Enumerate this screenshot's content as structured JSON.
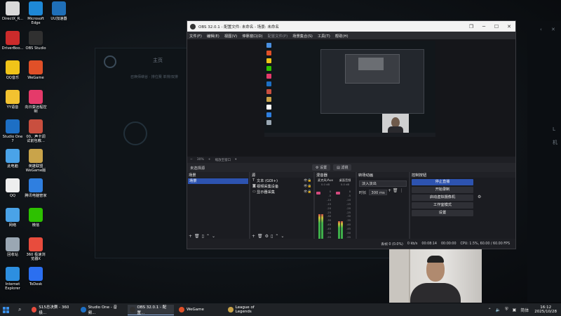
{
  "desktop": {
    "icons": [
      {
        "label": "DirectX_R...",
        "color": "#d9d9d9"
      },
      {
        "label": "Microsoft\nEdge",
        "color": "#1e88d6"
      },
      {
        "label": "UU加速器",
        "color": "#1f6fb8"
      },
      {
        "label": "DriverBoo...",
        "color": "#cc2b2b"
      },
      {
        "label": "OBS Studio",
        "color": "#303030"
      },
      {
        "label": "QQ音乐",
        "color": "#f0c419"
      },
      {
        "label": "WeGame",
        "color": "#e05028"
      },
      {
        "label": "YY语音",
        "color": "#f2c230"
      },
      {
        "label": "向日葵远程控\n制",
        "color": "#e53a6a"
      },
      {
        "label": "Studio One\n7",
        "color": "#1d6fc4"
      },
      {
        "label": "00、声卡调\n试前包教...",
        "color": "#c94f3f"
      },
      {
        "label": "此电脑",
        "color": "#4aa3e8"
      },
      {
        "label": "英雄联盟\nWeGame版",
        "color": "#c9a44a"
      },
      {
        "label": "QQ",
        "color": "#eeeeee"
      },
      {
        "label": "腾讯电脑管家",
        "color": "#2f7fe0"
      },
      {
        "label": "网络",
        "color": "#4aa3e8"
      },
      {
        "label": "微信",
        "color": "#2dc100"
      },
      {
        "label": "回收站",
        "color": "#9aa7b3"
      },
      {
        "label": "360 极速浏\n览器X",
        "color": "#e84c3d"
      },
      {
        "label": "Internet\nExplorer",
        "color": "#2d8fe0"
      },
      {
        "label": "ToDesk",
        "color": "#2b6ff0"
      }
    ]
  },
  "background_app": {
    "home": "主页",
    "search_hint": "召唤师峡谷 · 排位赛 单排/双排",
    "right_glyphs": [
      "‹",
      "✕"
    ],
    "right_labels": [
      "L",
      "机"
    ]
  },
  "obs": {
    "title": "OBS 32.0.1 - 配置文件: 未命名 - 场景: 未命名",
    "window_buttons": [
      "❐",
      "─",
      "☐",
      "✕"
    ],
    "menu": [
      "文件(F)",
      "编辑(E)",
      "视图(V)",
      "停靠窗口(D)",
      "配置文件(P)",
      "场景集合(S)",
      "工具(T)",
      "帮助(H)"
    ],
    "zoom_label": "30%",
    "zoom_hint": "缩放至窗口",
    "no_source": "未选择源",
    "props_button": "设置",
    "filters_button": "滤镜",
    "docks": {
      "scenes": {
        "title": "场景",
        "items": [
          "场景"
        ]
      },
      "sources": {
        "title": "源",
        "items": [
          {
            "icon": "T",
            "label": "文本 (GDI+)"
          },
          {
            "icon": "◙",
            "label": "视频采集设备"
          },
          {
            "icon": "▭",
            "label": "显示器采集"
          }
        ]
      },
      "mixer": {
        "title": "混音器",
        "channels": [
          {
            "name": "麦克风/Aux",
            "db": "0.0 dB",
            "level": 0.55
          },
          {
            "name": "桌面音频",
            "db": "0.0 dB",
            "level": 0.42
          }
        ],
        "scale": [
          "0",
          "-5",
          "-10",
          "-15",
          "-20",
          "-25",
          "-30",
          "-35",
          "-40",
          "-45",
          "-50",
          "-55",
          "-60"
        ]
      },
      "transitions": {
        "title": "转场动画",
        "selected": "淡入淡出",
        "duration_label": "时长",
        "duration": "300 ms"
      },
      "controls": {
        "title": "控制按钮",
        "buttons": [
          "停止直播",
          "开始录制",
          "启动虚拟摄像机",
          "工作室模式",
          "设置"
        ]
      }
    },
    "status": {
      "dropped": "丢帧 0 (0.0%)",
      "bitrate": "0 kb/s",
      "live": "00:08:14",
      "rec": "00:00:00",
      "cpu": "CPU: 1.5%, 60.00 / 60.00 FPS"
    }
  },
  "watermark": "",
  "taskbar": {
    "apps": [
      {
        "label": "S15总决赛 - 360极...",
        "color": "#e84c3d",
        "active": false
      },
      {
        "label": "Studio One - 音频...",
        "color": "#1d6fc4",
        "active": false
      },
      {
        "label": "OBS 32.0.1 - 配置...",
        "color": "#303030",
        "active": true
      },
      {
        "label": "WeGame",
        "color": "#e05028",
        "active": false
      },
      {
        "label": "League of Legends",
        "color": "#c9a44a",
        "active": false
      }
    ],
    "tray": {
      "lang": "简体",
      "time": "16:12",
      "date": "2025/10/28"
    }
  }
}
